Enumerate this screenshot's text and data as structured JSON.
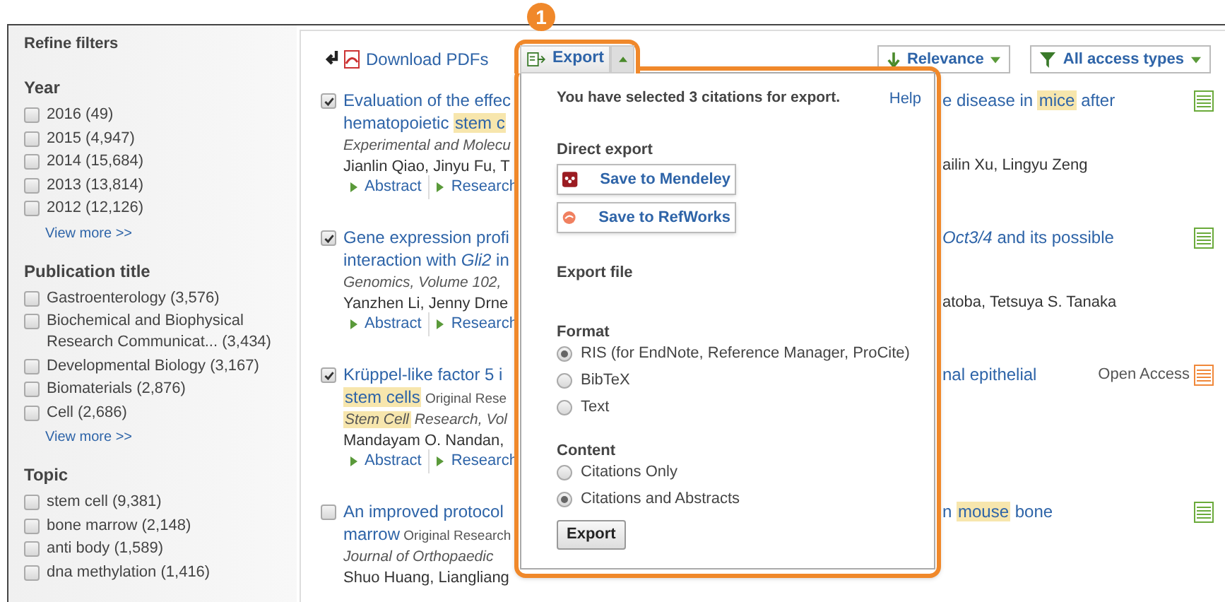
{
  "sidebar": {
    "title": "Refine filters",
    "sections": [
      {
        "heading": "Year",
        "items": [
          {
            "label": "2016",
            "count": "(49)",
            "checked": false
          },
          {
            "label": "2015",
            "count": "(4,947)",
            "checked": false
          },
          {
            "label": "2014",
            "count": "(15,684)",
            "checked": false
          },
          {
            "label": "2013",
            "count": "(13,814)",
            "checked": false
          },
          {
            "label": "2012",
            "count": "(12,126)",
            "checked": false
          }
        ],
        "more": "View more >>"
      },
      {
        "heading": "Publication title",
        "items": [
          {
            "label": "Gastroenterology",
            "count": "(3,576)",
            "checked": false
          },
          {
            "label": "Biochemical and Biophysical Research Communicat...",
            "count": "(3,434)",
            "checked": false
          },
          {
            "label": "Developmental Biology",
            "count": "(3,167)",
            "checked": false
          },
          {
            "label": "Biomaterials",
            "count": "(2,876)",
            "checked": false
          },
          {
            "label": "Cell",
            "count": "(2,686)",
            "checked": false
          }
        ],
        "more": "View more >>"
      },
      {
        "heading": "Topic",
        "items": [
          {
            "label": "stem cell",
            "count": "(9,381)",
            "checked": false
          },
          {
            "label": "bone marrow",
            "count": "(2,148)",
            "checked": false
          },
          {
            "label": "anti body",
            "count": "(1,589)",
            "checked": false
          },
          {
            "label": "dna methylation",
            "count": "(1,416)",
            "checked": false
          }
        ]
      }
    ]
  },
  "toolbar": {
    "download": "Download PDFs",
    "export": "Export",
    "sort": "Relevance",
    "access": "All access types"
  },
  "results": [
    {
      "checked": true,
      "access": {
        "kind": "standard"
      },
      "lines": [
        {
          "kind": "title",
          "left": [
            {
              "kind": "plain",
              "text": "Evaluation of the effec"
            }
          ],
          "right": [
            {
              "kind": "plain",
              "text": "e disease in "
            },
            {
              "kind": "mark",
              "text": "mice"
            },
            {
              "kind": "plain",
              "text": " after"
            }
          ]
        },
        {
          "kind": "title",
          "left": [
            {
              "kind": "plain",
              "text": "hematopoietic "
            },
            {
              "kind": "mark",
              "text": "stem c"
            }
          ]
        },
        {
          "kind": "journal",
          "left": [
            {
              "kind": "plain",
              "text": "Experimental and Molecu"
            }
          ]
        },
        {
          "kind": "authors",
          "left": [
            {
              "kind": "plain",
              "text": "Jianlin Qiao, Jinyu Fu, T"
            }
          ],
          "right": [
            {
              "kind": "plain",
              "text": "ailin Xu, Lingyu Zeng"
            }
          ]
        },
        {
          "kind": "links",
          "links": [
            "Abstract",
            "Research"
          ]
        }
      ]
    },
    {
      "checked": true,
      "access": {
        "kind": "standard"
      },
      "lines": [
        {
          "kind": "title",
          "left": [
            {
              "kind": "plain",
              "text": "Gene expression profi"
            }
          ],
          "right": [
            {
              "kind": "italic",
              "text": "Oct3/4"
            },
            {
              "kind": "plain",
              "text": " and its possible"
            }
          ]
        },
        {
          "kind": "title",
          "left": [
            {
              "kind": "plain",
              "text": "interaction with "
            },
            {
              "kind": "italic",
              "text": "Gli2"
            },
            {
              "kind": "plain",
              "text": " in"
            }
          ]
        },
        {
          "kind": "journal",
          "left": [
            {
              "kind": "plain",
              "text": "Genomics, Volume 102,"
            }
          ]
        },
        {
          "kind": "authors",
          "left": [
            {
              "kind": "plain",
              "text": "Yanzhen Li, Jenny Drne"
            }
          ],
          "right": [
            {
              "kind": "plain",
              "text": "atoba, Tetsuya S. Tanaka"
            }
          ]
        },
        {
          "kind": "links",
          "links": [
            "Abstract",
            "Research"
          ]
        }
      ]
    },
    {
      "checked": true,
      "access": {
        "kind": "open",
        "label": "Open Access"
      },
      "lines": [
        {
          "kind": "title",
          "left": [
            {
              "kind": "plain",
              "text": "Krüppel-like factor 5 i"
            }
          ],
          "right": [
            {
              "kind": "plain",
              "text": "nal epithelial"
            }
          ]
        },
        {
          "kind": "title",
          "left": [
            {
              "kind": "mark",
              "text": "stem cells"
            },
            {
              "kind": "tag",
              "text": " Original Rese"
            }
          ]
        },
        {
          "kind": "journal",
          "left": [
            {
              "kind": "mark",
              "text": "Stem Cell"
            },
            {
              "kind": "plain",
              "text": " Research, Vol"
            }
          ]
        },
        {
          "kind": "authors",
          "left": [
            {
              "kind": "plain",
              "text": "Mandayam O. Nandan,"
            }
          ]
        },
        {
          "kind": "links",
          "links": [
            "Abstract",
            "Research"
          ]
        }
      ]
    },
    {
      "checked": false,
      "access": {
        "kind": "standard"
      },
      "lines": [
        {
          "kind": "title",
          "left": [
            {
              "kind": "plain",
              "text": "An improved protocol"
            }
          ],
          "right": [
            {
              "kind": "plain",
              "text": "n "
            },
            {
              "kind": "mark",
              "text": "mouse"
            },
            {
              "kind": "plain",
              "text": " bone"
            }
          ]
        },
        {
          "kind": "title",
          "left": [
            {
              "kind": "plain",
              "text": "marrow"
            },
            {
              "kind": "tag",
              "text": " Original Research"
            }
          ]
        },
        {
          "kind": "journal",
          "left": [
            {
              "kind": "plain",
              "text": "Journal of Orthopaedic"
            }
          ]
        },
        {
          "kind": "authors",
          "left": [
            {
              "kind": "plain",
              "text": "Shuo Huang, Liangliang"
            }
          ]
        }
      ]
    }
  ],
  "export_panel": {
    "badge": "1",
    "summary": "You have selected 3 citations for export.",
    "help": "Help",
    "direct_heading": "Direct export",
    "direct_buttons": [
      {
        "kind": "mendeley",
        "label": "Save to Mendeley"
      },
      {
        "kind": "refworks",
        "label": "Save to RefWorks"
      }
    ],
    "file_heading": "Export file",
    "format_heading": "Format",
    "formats": [
      {
        "label": "RIS (for EndNote, Reference Manager, ProCite)",
        "selected": true
      },
      {
        "label": "BibTeX",
        "selected": false
      },
      {
        "label": "Text",
        "selected": false
      }
    ],
    "content_heading": "Content",
    "contents": [
      {
        "label": "Citations Only",
        "selected": false
      },
      {
        "label": "Citations and Abstracts",
        "selected": true
      }
    ],
    "submit": "Export"
  }
}
